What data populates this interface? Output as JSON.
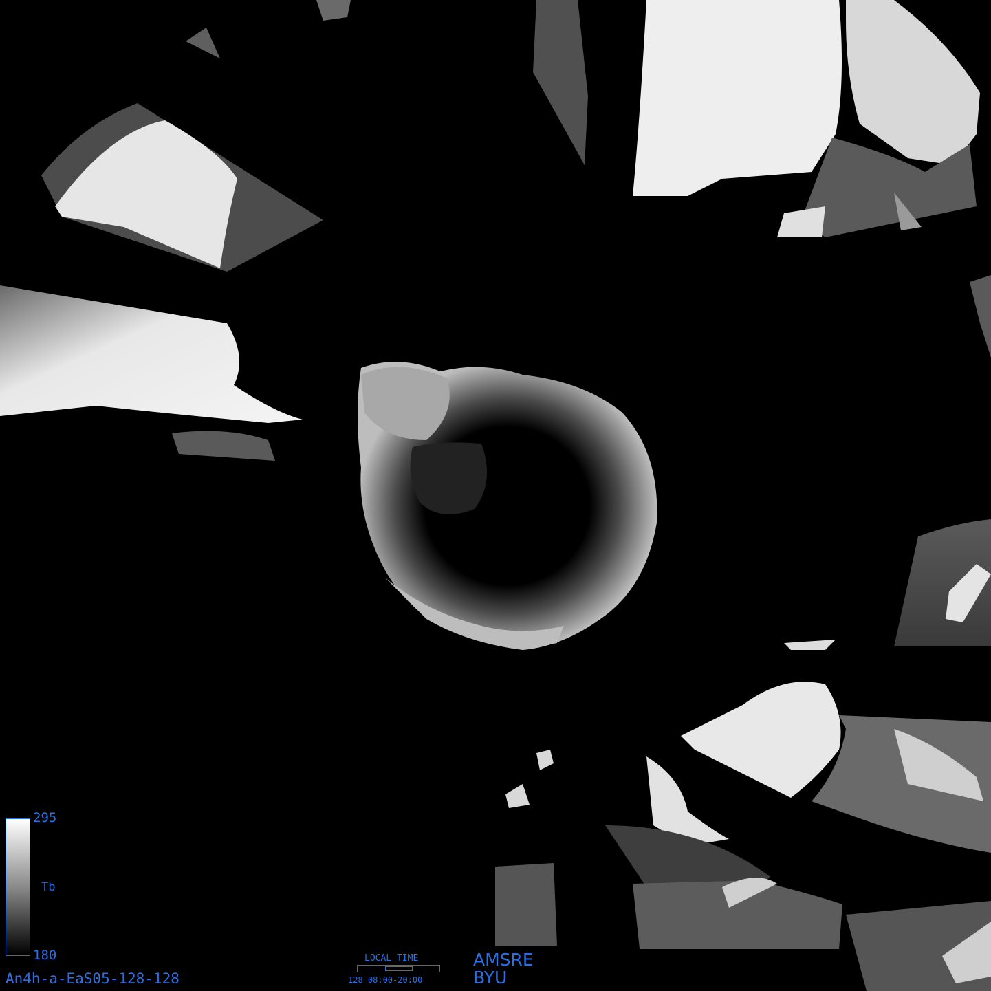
{
  "image": {
    "id_label": "An4h-a-EaS05-128-128",
    "background_color": "#000000"
  },
  "colorbar": {
    "max_label": "295",
    "min_label": "180",
    "variable_label": "Tb",
    "colors": [
      "#ffffff",
      "#000000"
    ]
  },
  "time_panel": {
    "title": "LOCAL TIME",
    "range_label": "128 08:00-20:00"
  },
  "credits": {
    "sensor": "AMSRE",
    "organization": "BYU"
  },
  "accent_color": "#2a6fe8"
}
